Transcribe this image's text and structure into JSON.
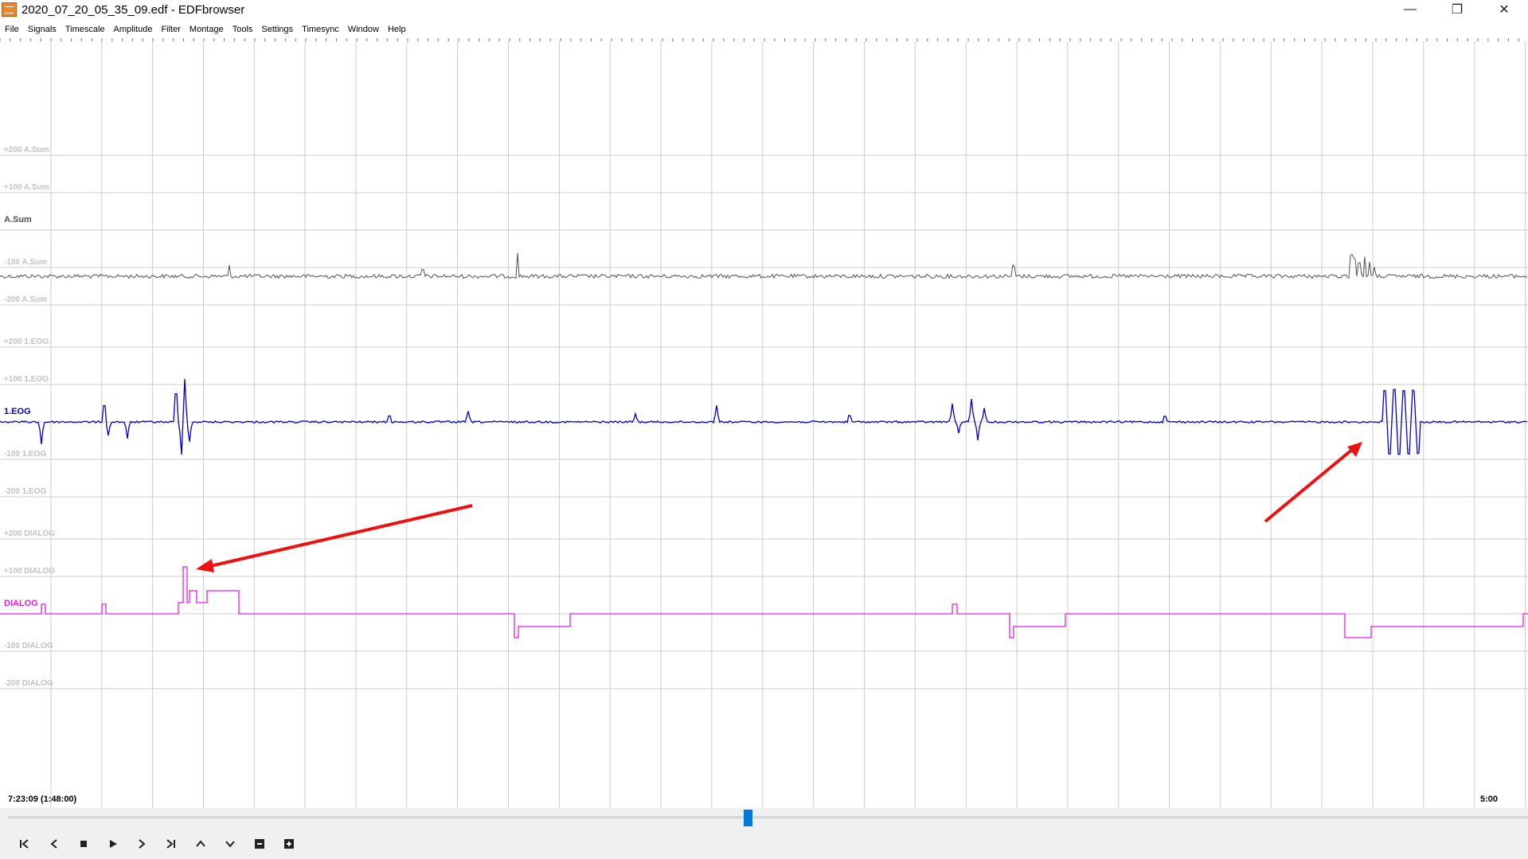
{
  "window": {
    "title": "2020_07_20_05_35_09.edf - EDFbrowser",
    "icon": "edfbrowser-app-icon",
    "controls": [
      "minimize-icon",
      "restore-icon",
      "close-icon"
    ]
  },
  "menu": [
    "File",
    "Signals",
    "Timescale",
    "Amplitude",
    "Filter",
    "Montage",
    "Tools",
    "Settings",
    "Timesync",
    "Window",
    "Help"
  ],
  "signals": [
    {
      "name": "A.Sum",
      "color": "#505050",
      "ticks": [
        "+200 A.Sum",
        "+100 A.Sum",
        "-100 A.Sum",
        "-200 A.Sum"
      ]
    },
    {
      "name": "1.EOG",
      "color": "#0000cc",
      "ticks": [
        "+200 1.EOG",
        "+100 1.EOG",
        "-100 1.EOG",
        "-200 1.EOG"
      ]
    },
    {
      "name": "DIALOG",
      "color": "#e020e0",
      "ticks": [
        "+200 DIALOG",
        "+100 DIALOG",
        "-100 DIALOG",
        "-200 DIALOG"
      ]
    }
  ],
  "colors": {
    "grid": "#cccccc",
    "annotation_arrow": "#ee1111",
    "scroll_thumb": "#0078d7",
    "ruler": "#4a7fc0"
  },
  "status": {
    "time_position": "7:23:09 (1:48:00)",
    "page_length": "5:00"
  },
  "navigation": [
    "first-page-icon",
    "previous-icon",
    "stop-icon",
    "play-icon",
    "next-icon",
    "last-page-icon",
    "scroll-up-icon",
    "scroll-down-icon",
    "zoom-out-icon",
    "zoom-in-icon"
  ]
}
